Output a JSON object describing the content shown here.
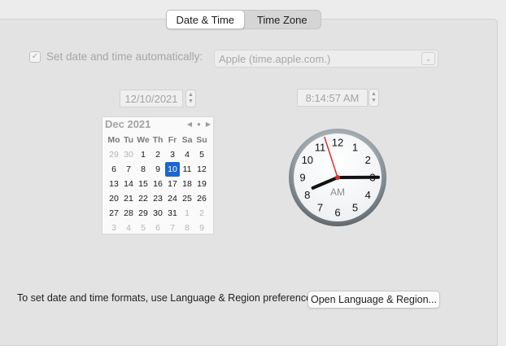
{
  "tabs": [
    {
      "label": "Date & Time",
      "active": true
    },
    {
      "label": "Time Zone",
      "active": false
    }
  ],
  "auto_set": {
    "checked": true,
    "label": "Set date and time automatically:"
  },
  "time_server": {
    "value": "Apple (time.apple.com.)"
  },
  "date_field": {
    "value": "12/10/2021"
  },
  "time_field": {
    "value": "8:14:57 AM"
  },
  "calendar": {
    "month_label": "Dec 2021",
    "weekdays": [
      "Mo",
      "Tu",
      "We",
      "Th",
      "Fr",
      "Sa",
      "Su"
    ],
    "selected_day": "10",
    "weeks": [
      [
        "29",
        "30",
        "1",
        "2",
        "3",
        "4",
        "5"
      ],
      [
        "6",
        "7",
        "8",
        "9",
        "10",
        "11",
        "12"
      ],
      [
        "13",
        "14",
        "15",
        "16",
        "17",
        "18",
        "19"
      ],
      [
        "20",
        "21",
        "22",
        "23",
        "24",
        "25",
        "26"
      ],
      [
        "27",
        "28",
        "29",
        "30",
        "31",
        "1",
        "2"
      ],
      [
        "3",
        "4",
        "5",
        "6",
        "7",
        "8",
        "9"
      ]
    ]
  },
  "clock": {
    "numbers": [
      "12",
      "1",
      "2",
      "3",
      "4",
      "5",
      "6",
      "7",
      "8",
      "9",
      "10",
      "11"
    ],
    "ampm": "AM",
    "time": {
      "hour": 8,
      "minute": 14,
      "second": 57
    }
  },
  "footer": {
    "text": "To set date and time formats, use Language & Region preferences.",
    "button_label": "Open Language & Region..."
  },
  "colors": {
    "accent": "#1b66d1",
    "second_hand": "#e02a2a"
  }
}
